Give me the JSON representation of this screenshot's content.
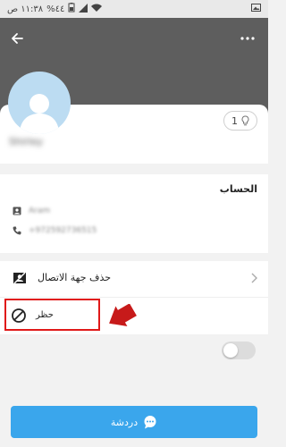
{
  "status_bar": {
    "time": "١١:٣٨ ص",
    "battery": "%٤٤"
  },
  "profile": {
    "name": "Shirley",
    "tip_count": "1"
  },
  "account": {
    "title": "الحساب",
    "username": "Aram",
    "phone": "+972592736515"
  },
  "actions": {
    "delete_contact": "حذف جهة الاتصال",
    "block": "حظر",
    "block_enabled": false
  },
  "chat_button": {
    "label": "دردشة"
  },
  "colors": {
    "header_bg": "#5e5e5e",
    "accent": "#3aa6ec",
    "highlight": "#e01919",
    "arrow": "#c71a1a"
  }
}
